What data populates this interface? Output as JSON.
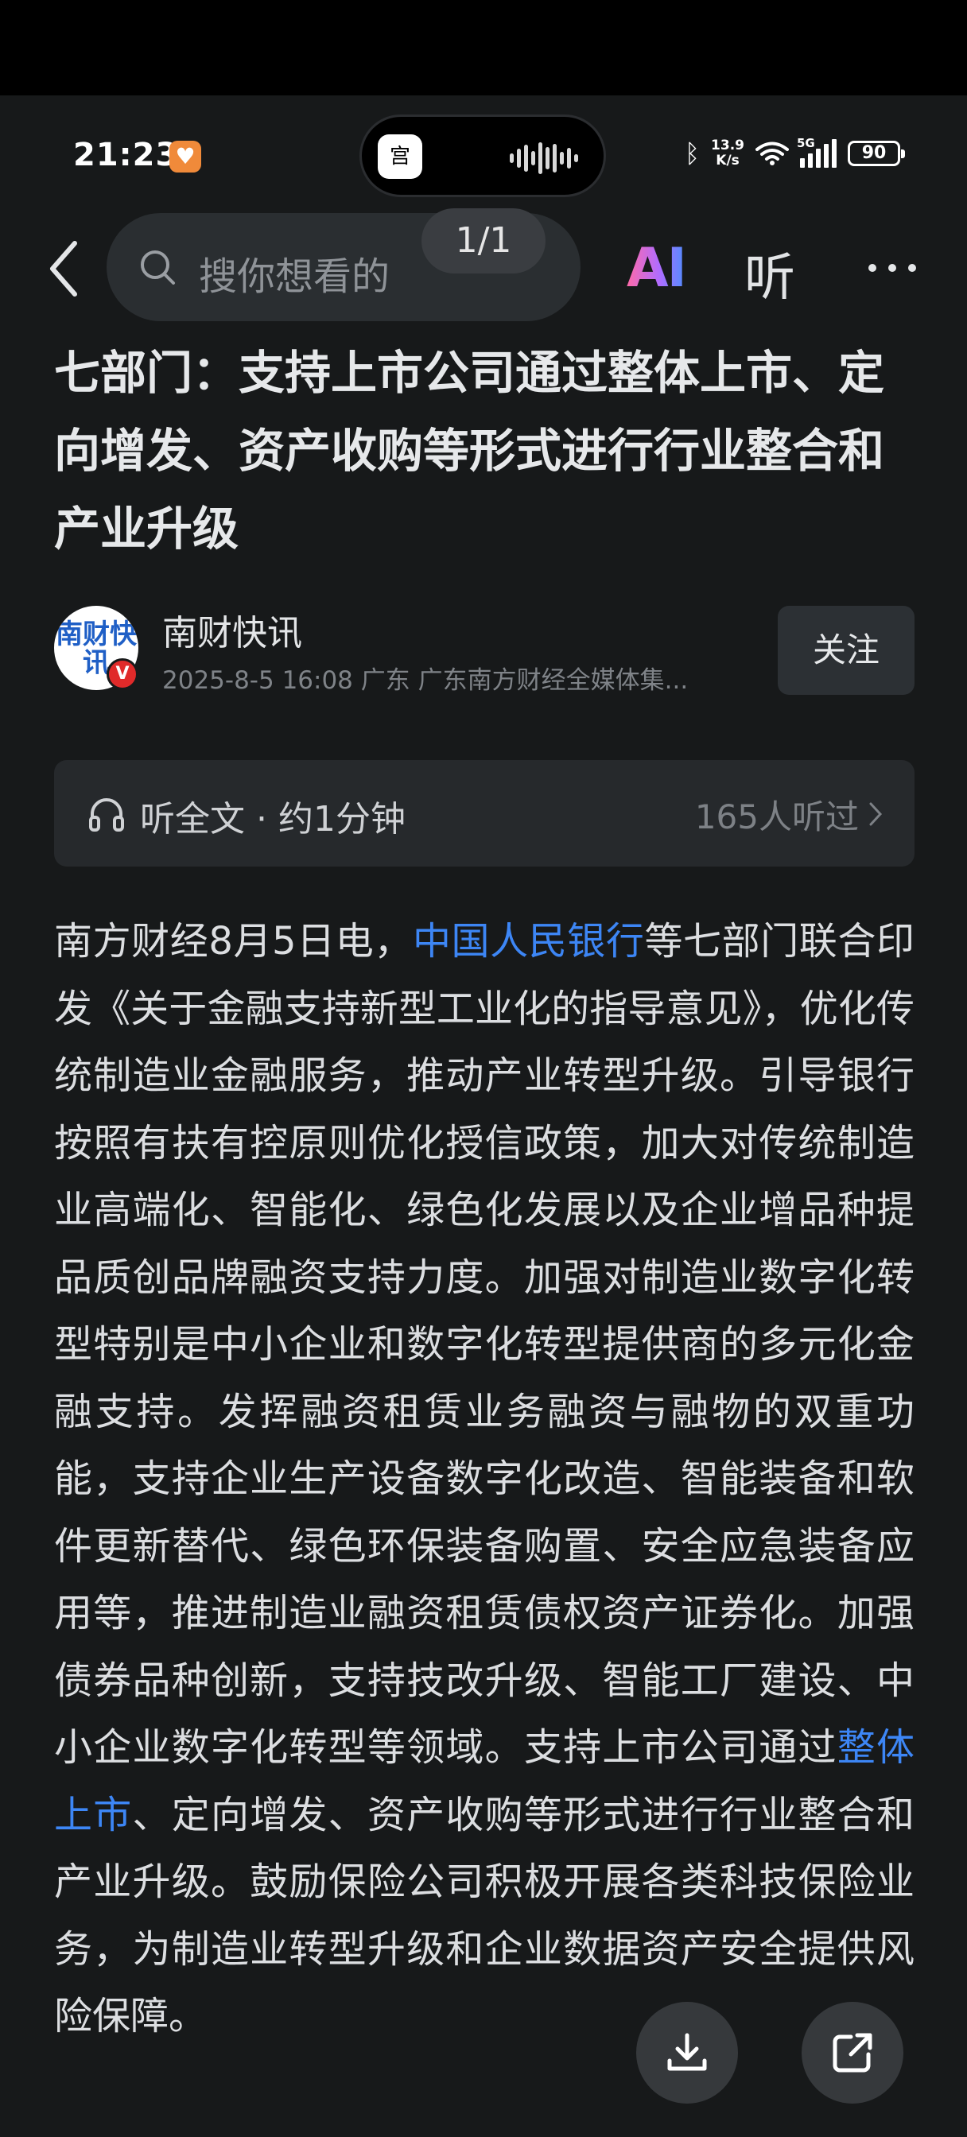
{
  "status_bar": {
    "time": "21:23",
    "network_speed_value": "13.9",
    "network_speed_unit": "K/s",
    "network_type": "5G",
    "battery": "90",
    "island_app_glyph": "宫"
  },
  "nav": {
    "search_placeholder": "搜你想看的",
    "page_indicator": "1/1",
    "ai_label": "AI",
    "listen_label": "听"
  },
  "article": {
    "title": "七部门：支持上市公司通过整体上市、定向增发、资产收购等形式进行行业整合和产业升级",
    "author": {
      "avatar_text": "南财快讯",
      "verified_mark": "V",
      "name": "南财快讯",
      "meta": "2025-8-5  16:08  广东  广东南方财经全媒体集...",
      "follow_label": "关注"
    },
    "listen": {
      "label": "听全文 · 约1分钟",
      "count": "165人听过"
    },
    "body": {
      "part1": "南方财经8月5日电，",
      "link1": "中国人民银行",
      "part2": "等七部门联合印发《关于金融支持新型工业化的指导意见》，优化传统制造业金融服务，推动产业转型升级。引导银行按照有扶有控原则优化授信政策，加大对传统制造业高端化、智能化、绿色化发展以及企业增品种提品质创品牌融资支持力度。加强对制造业数字化转型特别是中小企业和数字化转型提供商的多元化金融支持。发挥融资租赁业务融资与融物的双重功能，支持企业生产设备数字化改造、智能装备和软件更新替代、绿色环保装备购置、安全应急装备应用等，推进制造业融资租赁债权资产证券化。加强债券品种创新，支持技改升级、智能工厂建设、中小企业数字化转型等领域。支持上市公司通过",
      "link2": "整体上市",
      "part3": "、定向增发、资产收购等形式进行行业整合和产业升级。鼓励保险公司积极开展各类科技保险业务，为制造业转型升级和企业数据资产安全提供风险保障。"
    }
  },
  "colors": {
    "background": "#17191a",
    "link": "#3d86f5",
    "accent_badge": "#f08a3a"
  }
}
